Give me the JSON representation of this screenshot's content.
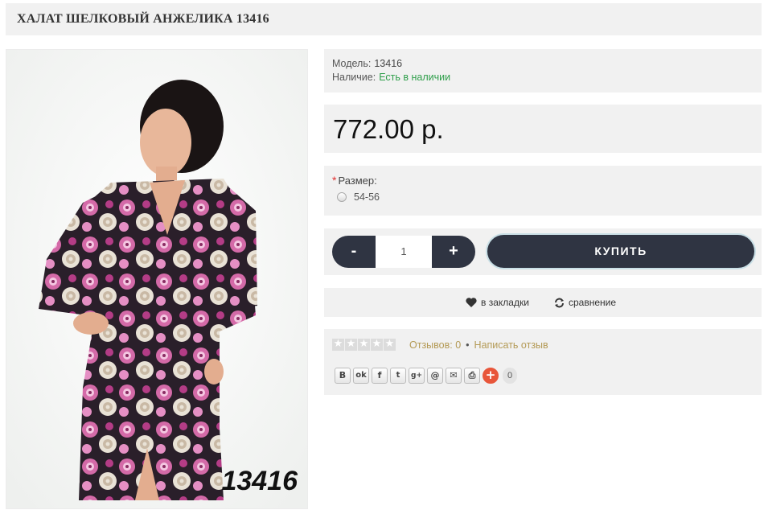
{
  "product": {
    "title": "ХАЛАТ ШЕЛКОВЫЙ АНЖЕЛИКА 13416",
    "image_caption": "13416"
  },
  "info": {
    "model_label": "Модель:",
    "model_value": "13416",
    "stock_label": "Наличие:",
    "stock_value": "Есть в наличии"
  },
  "price": "772.00 р.",
  "options": {
    "required_mark": "*",
    "size_label": "Размер:",
    "size_option": "54-56"
  },
  "purchase": {
    "minus_label": "-",
    "quantity": "1",
    "plus_label": "+",
    "buy_label": "КУПИТЬ"
  },
  "actions": {
    "wishlist_label": "в закладки",
    "compare_label": "сравнение"
  },
  "reviews": {
    "rating": 0,
    "max_rating": 5,
    "reviews_text": "Отзывов: 0",
    "separator": "•",
    "write_review": "Написать отзыв"
  },
  "share": {
    "buttons": [
      "В",
      "ok",
      "f",
      "twitter",
      "g+",
      "@",
      "mail",
      "print"
    ],
    "count": "0"
  },
  "colors": {
    "panel_bg": "#f1f1f1",
    "dark_button": "#2f3442",
    "stock_green": "#2e9e4a",
    "review_gold": "#b49a55",
    "share_plus": "#e8563a"
  }
}
